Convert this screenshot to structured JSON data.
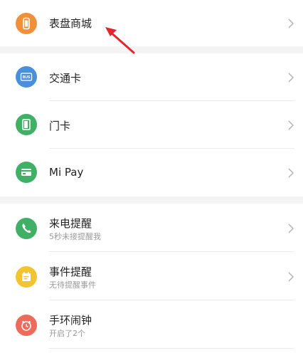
{
  "items": [
    {
      "label": "表盘商城",
      "sublabel": "",
      "icon": "watch-icon",
      "color": "#f0913a"
    },
    {
      "label": "交通卡",
      "sublabel": "",
      "icon": "bus-card-icon",
      "color": "#4a8fde"
    },
    {
      "label": "门卡",
      "sublabel": "",
      "icon": "door-icon",
      "color": "#3fb065"
    },
    {
      "label": "Mi Pay",
      "sublabel": "",
      "icon": "wallet-card-icon",
      "color": "#3fb065"
    },
    {
      "label": "来电提醒",
      "sublabel": "5秒未接提醒我",
      "icon": "phone-icon",
      "color": "#3fb065"
    },
    {
      "label": "事件提醒",
      "sublabel": "无待提醒事件",
      "icon": "calendar-icon",
      "color": "#f4c430"
    },
    {
      "label": "手环闹钟",
      "sublabel": "开启了2个",
      "icon": "alarm-clock-icon",
      "color": "#ee6a5a"
    }
  ],
  "bus_badge_text": "BUS",
  "annotation": {
    "color": "#e0282e",
    "icon": "red-arrow-annotation"
  }
}
